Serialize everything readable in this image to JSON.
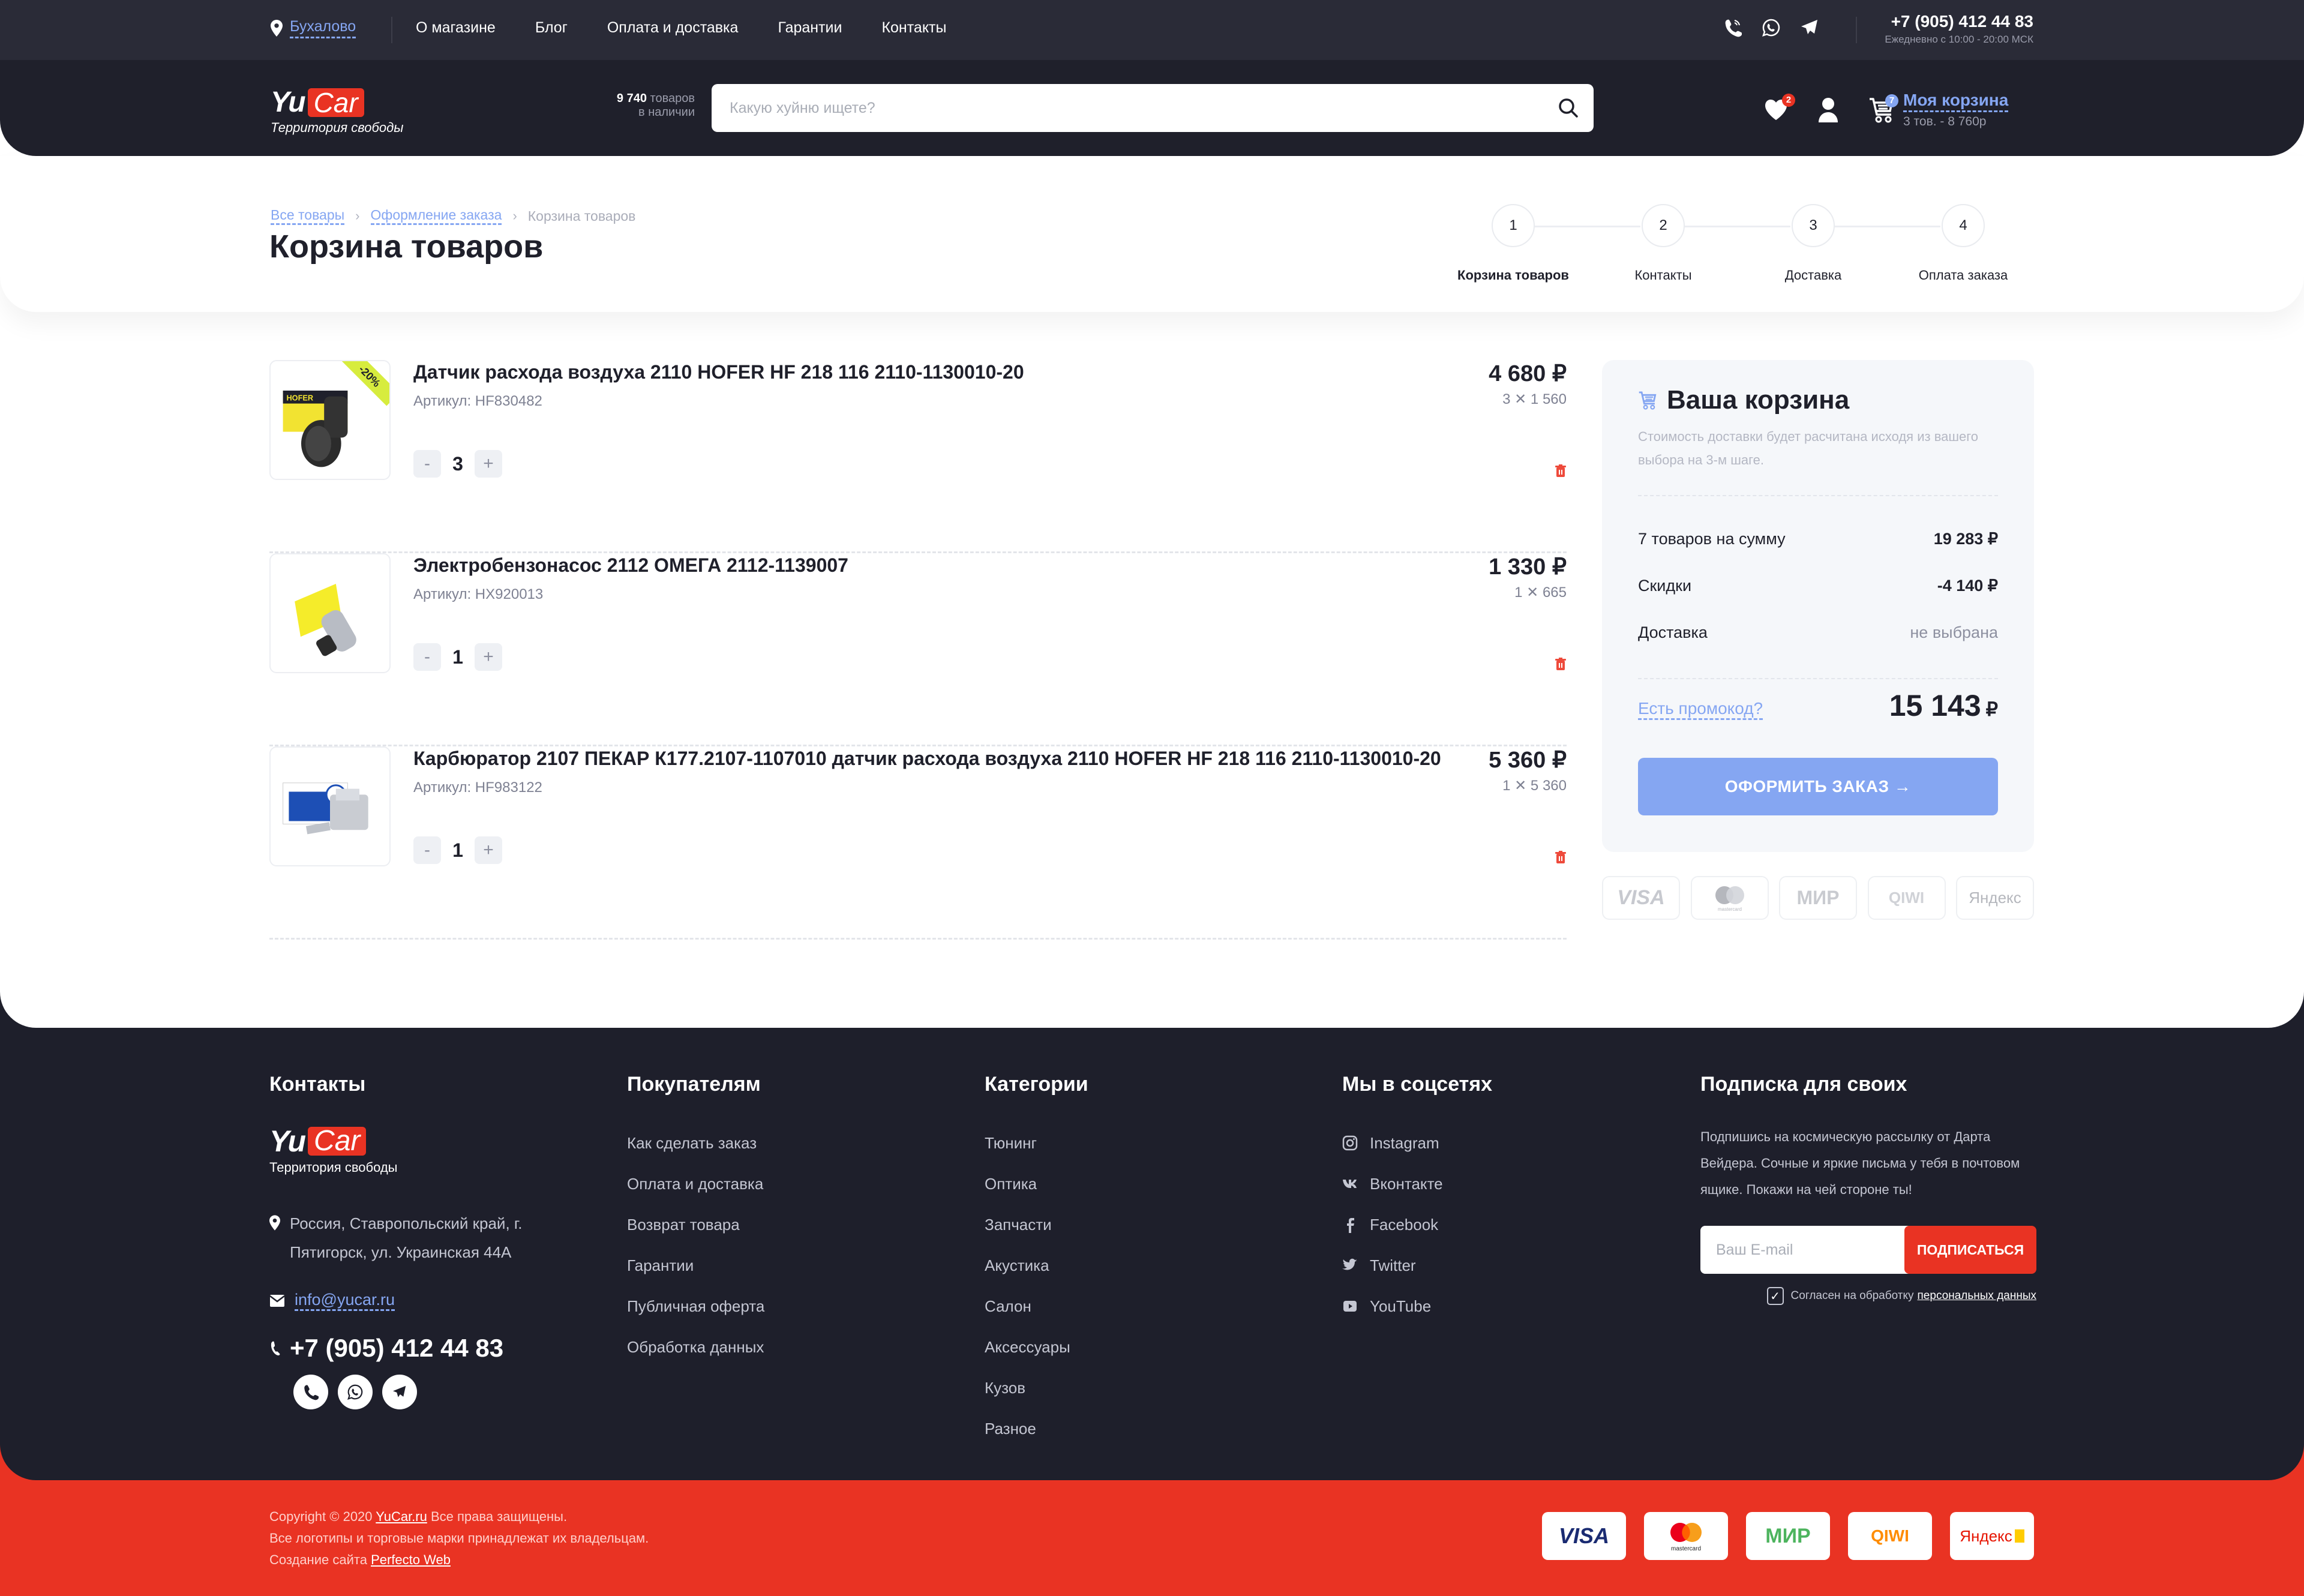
{
  "topbar": {
    "city": "Бухалово",
    "nav": [
      "О магазине",
      "Блог",
      "Оплата и доставка",
      "Гарантии",
      "Контакты"
    ],
    "phone": "+7 (905) 412 44 83",
    "hours": "Ежедневно с 10:00 - 20:00 МСК"
  },
  "header": {
    "logo_yu": "Yu",
    "logo_car": "Car",
    "tagline": "Территория свободы",
    "stock_count": "9 740",
    "stock_word": "товаров",
    "stock_line2": "в наличии",
    "search_placeholder": "Какую хуйню ищете?",
    "favorites_count": "2",
    "cart_count": "7",
    "cart_label": "Моя корзина",
    "cart_summary": "3 тов. - 8 760р"
  },
  "breadcrumb": [
    {
      "label": "Все товары"
    },
    {
      "label": "Оформление заказа"
    },
    {
      "label": "Корзина товаров"
    }
  ],
  "page_title": "Корзина товаров",
  "steps": [
    {
      "num": "1",
      "label": "Корзина товаров",
      "active": true
    },
    {
      "num": "2",
      "label": "Контакты",
      "active": false
    },
    {
      "num": "3",
      "label": "Доставка",
      "active": false
    },
    {
      "num": "4",
      "label": "Оплата заказа",
      "active": false
    }
  ],
  "cart_items": [
    {
      "name": "Датчик расхода воздуха 2110 HOFER HF 218 116 2110-1130010-20",
      "sku": "Артикул: HF830482",
      "qty": "3",
      "price": "4 680 ₽",
      "unit": "3 ✕ 1 560",
      "discount": "-20%"
    },
    {
      "name": "Электробензонасос 2112 ОМЕГА 2112-1139007",
      "sku": "Артикул: HX920013",
      "qty": "1",
      "price": "1 330 ₽",
      "unit": "1 ✕ 665",
      "discount": null
    },
    {
      "name": "Карбюратор 2107 ПЕКАР К177.2107-1107010 датчик расхода воздуха 2110 HOFER HF 218 116 2110-1130010-20",
      "sku": "Артикул: HF983122",
      "qty": "1",
      "price": "5 360 ₽",
      "unit": "1 ✕ 5 360",
      "discount": null
    }
  ],
  "qty_minus": "-",
  "qty_plus": "+",
  "summary": {
    "title": "Ваша корзина",
    "note": "Стоимость доставки будет расчитана исходя из вашего выбора на 3-м шаге.",
    "rows": [
      {
        "label": "7 товаров на сумму",
        "value": "19 283 ₽"
      },
      {
        "label": "Скидки",
        "value": "-4 140 ₽"
      },
      {
        "label": "Доставка",
        "value": "не выбрана"
      }
    ],
    "promo_link": "Есть промокод?",
    "total": "15 143",
    "currency": "₽",
    "checkout_button": "ОФОРМИТЬ ЗАКАЗ →"
  },
  "payment_methods": [
    "VISA",
    "mastercard",
    "МИР",
    "QIWI",
    "Яндекс"
  ],
  "footer": {
    "contacts": {
      "title": "Контакты",
      "tagline": "Территория свободы",
      "address": "Россия, Ставропольский край, г. Пятигорск, ул. Украинская 44А",
      "email": "info@yucar.ru",
      "phone": "+7 (905) 412 44 83"
    },
    "buyers": {
      "title": "Покупателям",
      "links": [
        "Как сделать заказ",
        "Оплата и доставка",
        "Возврат товара",
        "Гарантии",
        "Публичная оферта",
        "Обработка данных"
      ]
    },
    "categories": {
      "title": "Категории",
      "links": [
        "Тюнинг",
        "Оптика",
        "Запчасти",
        "Акустика",
        "Салон",
        "Аксессуары",
        "Кузов",
        "Разное"
      ]
    },
    "social": {
      "title": "Мы в соцсетях",
      "links": [
        {
          "label": "Instagram",
          "icon": "instagram-icon"
        },
        {
          "label": "Вконтакте",
          "icon": "vk-icon"
        },
        {
          "label": "Facebook",
          "icon": "facebook-icon"
        },
        {
          "label": "Twitter",
          "icon": "twitter-icon"
        },
        {
          "label": "YouTube",
          "icon": "youtube-icon"
        }
      ]
    },
    "subscribe": {
      "title": "Подписка для своих",
      "desc": "Подпишись на космическую рассылку от Дарта Вейдера. Сочные и яркие письма у тебя в почтовом ящике. Покажи на чей стороне ты!",
      "email_placeholder": "Ваш E-mail",
      "button": "ПОДПИСАТЬСЯ",
      "agree_text": "Согласен на обработку",
      "agree_link": "персональных данных",
      "agree_checked": true
    },
    "copyright_prefix": "Copyright © 2020",
    "copyright_link": "YuCar.ru",
    "copyright_suffix": "Все права защищены.",
    "trademarks": "Все логотипы и торговые марки принадлежат их владельцам.",
    "made_by_prefix": "Создание сайта",
    "made_by_link": "Perfecto Web"
  },
  "colors": {
    "dark": "#1f202b",
    "accent_red": "#e93323",
    "accent_blue": "#85a6f2"
  }
}
